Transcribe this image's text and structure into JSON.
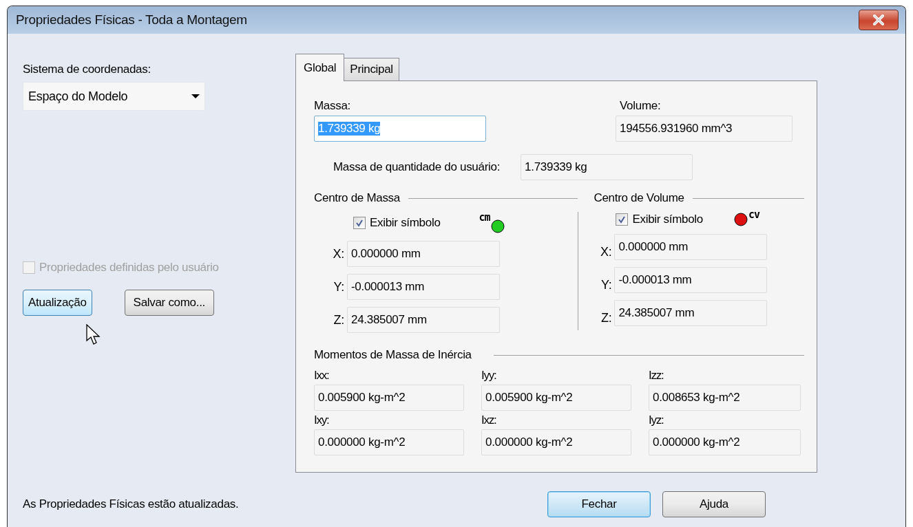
{
  "window": {
    "title": "Propriedades Físicas - Toda a Montagem"
  },
  "coordinate_system": {
    "label": "Sistema de coordenadas:",
    "value": "Espaço do Modelo"
  },
  "user_defined": {
    "label": "Propriedades definidas pelo usuário",
    "checked": false,
    "disabled": true
  },
  "buttons": [
    {
      "label": "Atualização",
      "hovered": true
    },
    {
      "label": "Salvar como...",
      "hovered": false
    }
  ],
  "tabs": [
    {
      "label": "Global",
      "selected": true
    },
    {
      "label": "Principal",
      "selected": false
    }
  ],
  "mass": {
    "label": "Massa:",
    "value": "1.739339 kg",
    "text_selected": true
  },
  "volume": {
    "label": "Volume:",
    "value": "194556.931960 mm^3"
  },
  "user_mass": {
    "label": "Massa de quantidade do usuário:",
    "value": "1.739339 kg"
  },
  "centers": [
    {
      "title": "Centro de Massa",
      "show_label": "Exibir símbolo",
      "checked": true,
      "symbol": "cm",
      "color": "#22cc22",
      "kind": "leading",
      "coords": [
        {
          "axis": "X:",
          "value": "0.000000 mm"
        },
        {
          "axis": "Y:",
          "value": "-0.000013 mm"
        },
        {
          "axis": "Z:",
          "value": "24.385007 mm"
        }
      ]
    },
    {
      "title": "Centro de Volume",
      "show_label": "Exibir símbolo",
      "checked": true,
      "symbol": "cv",
      "color": "#dd1111",
      "kind": "trailing",
      "coords": [
        {
          "axis": "X:",
          "value": "0.000000 mm"
        },
        {
          "axis": "Y:",
          "value": "-0.000013 mm"
        },
        {
          "axis": "Z:",
          "value": "24.385007 mm"
        }
      ]
    }
  ],
  "inertia": {
    "title": "Momentos de Massa de Inércia",
    "items": [
      {
        "label": "Ixx:",
        "value": "0.005900 kg-m^2"
      },
      {
        "label": "Iyy:",
        "value": "0.005900 kg-m^2"
      },
      {
        "label": "Izz:",
        "value": "0.008653 kg-m^2"
      },
      {
        "label": "Ixy:",
        "value": "0.000000 kg-m^2"
      },
      {
        "label": "Ixz:",
        "value": "0.000000 kg-m^2"
      },
      {
        "label": "Iyz:",
        "value": "0.000000 kg-m^2"
      }
    ]
  },
  "status": "As Propriedades Físicas estão atualizadas.",
  "footer_buttons": [
    {
      "label": "Fechar",
      "default": true
    },
    {
      "label": "Ajuda",
      "default": false
    }
  ]
}
